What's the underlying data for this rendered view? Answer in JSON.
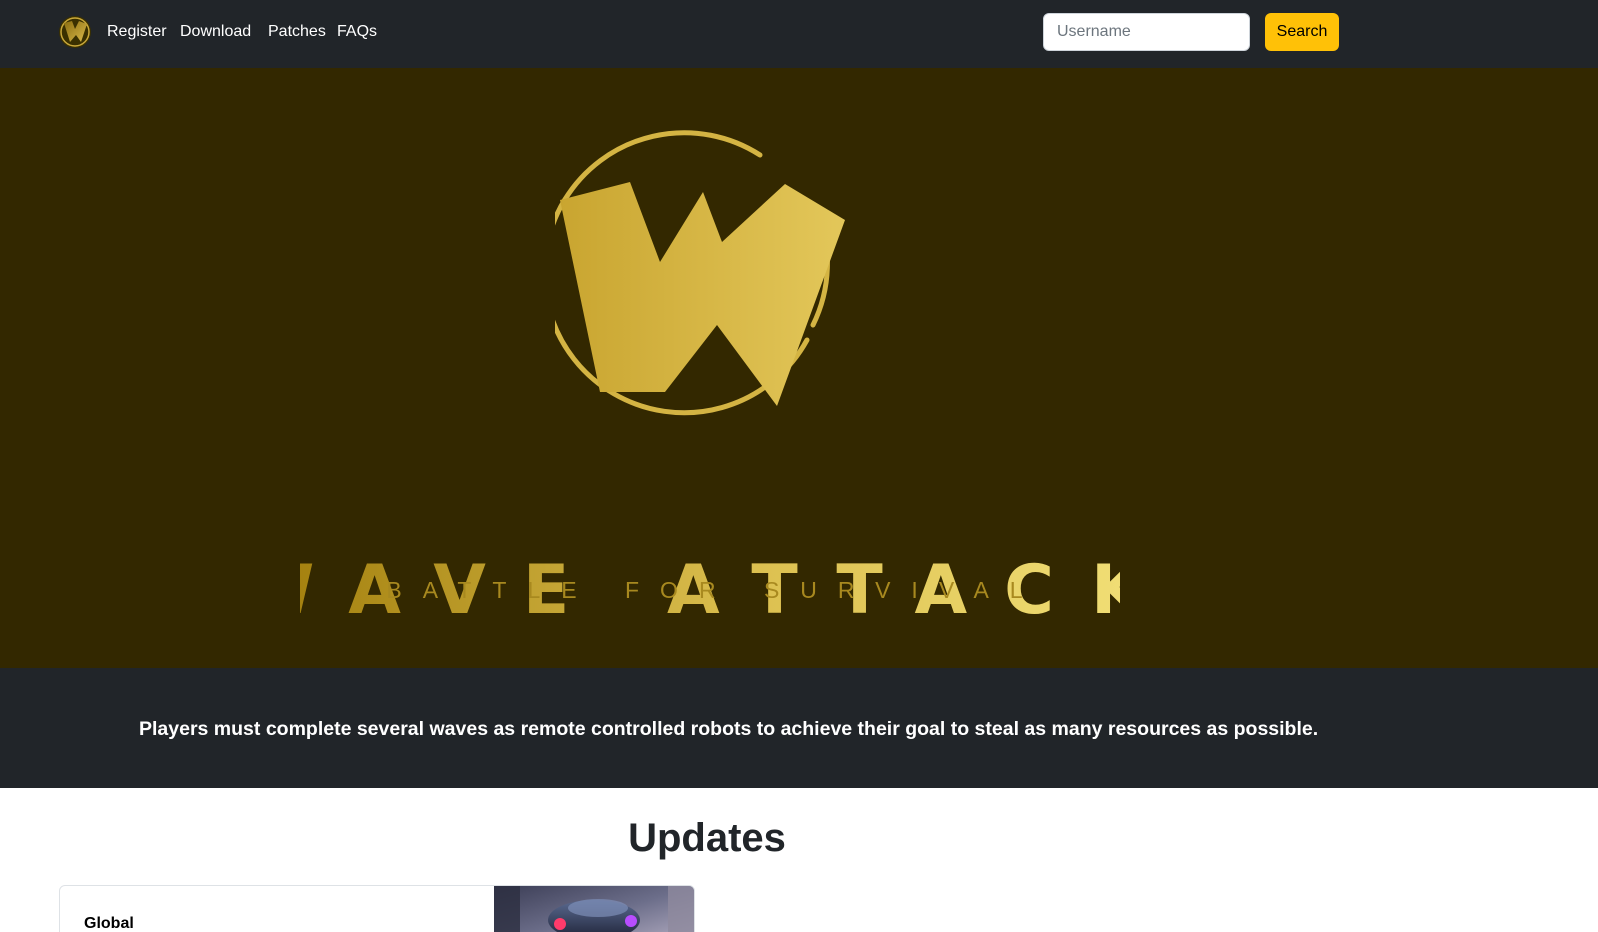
{
  "navbar": {
    "brand_icon": "wave-attack-logo-icon",
    "links": [
      "Register",
      "Download",
      "Patches",
      "FAQs"
    ],
    "search": {
      "placeholder": "Username",
      "value": "",
      "button_label": "Search"
    }
  },
  "hero": {
    "logo_letter": "W",
    "title": "WAVE ATTACK",
    "subtitle": "BATTLE FOR SURVIVAL",
    "colors": {
      "background": "#332800",
      "gold_light": "#e6cc5c",
      "gold_dark": "#a8891f"
    }
  },
  "tagline": "Players must complete several waves as remote controlled robots to achieve their goal to steal as many resources as possible.",
  "updates": {
    "heading": "Updates",
    "cards": [
      {
        "title": "Global",
        "image_icon": "robot-image-icon"
      }
    ]
  },
  "colors": {
    "navbar": "#212529",
    "accent_button": "#ffc107"
  }
}
